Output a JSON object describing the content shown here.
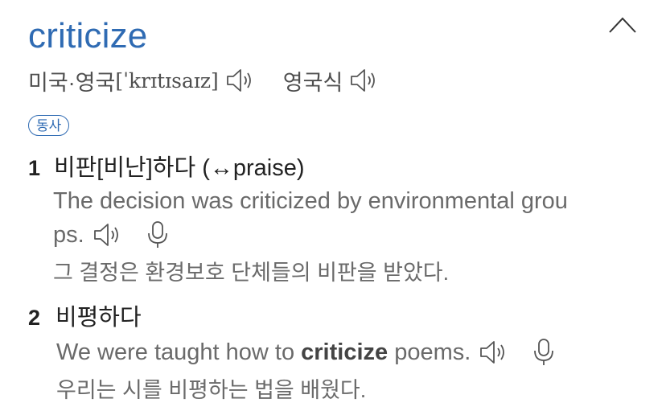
{
  "entry": {
    "headword": "criticize",
    "pronunciation": {
      "us_uk_label": "미국·영국",
      "ipa": "[ˈkrɪtɪsaɪz]",
      "uk_label": "영국식"
    },
    "part_of_speech": "동사",
    "senses": [
      {
        "number": "1",
        "definition": "비판[비난]하다 (↔praise)",
        "example_en_line1": "The decision was criticized by environmental grou",
        "example_en_line2": "ps.",
        "example_ko": "그 결정은 환경보호 단체들의 비판을 받았다."
      },
      {
        "number": "2",
        "definition": "비평하다",
        "example_en_before": "We were taught how to",
        "example_en_bold": "criticize",
        "example_en_after": "poems.",
        "example_ko": "우리는 시를 비평하는 법을 배웠다."
      }
    ]
  },
  "icons": {
    "collapse": "chevron-up-icon",
    "audio": "speaker-icon",
    "record": "microphone-icon"
  },
  "colors": {
    "headword": "#2f6bb3",
    "badge": "#2f6bb3",
    "example_text": "#6a6a6a"
  }
}
